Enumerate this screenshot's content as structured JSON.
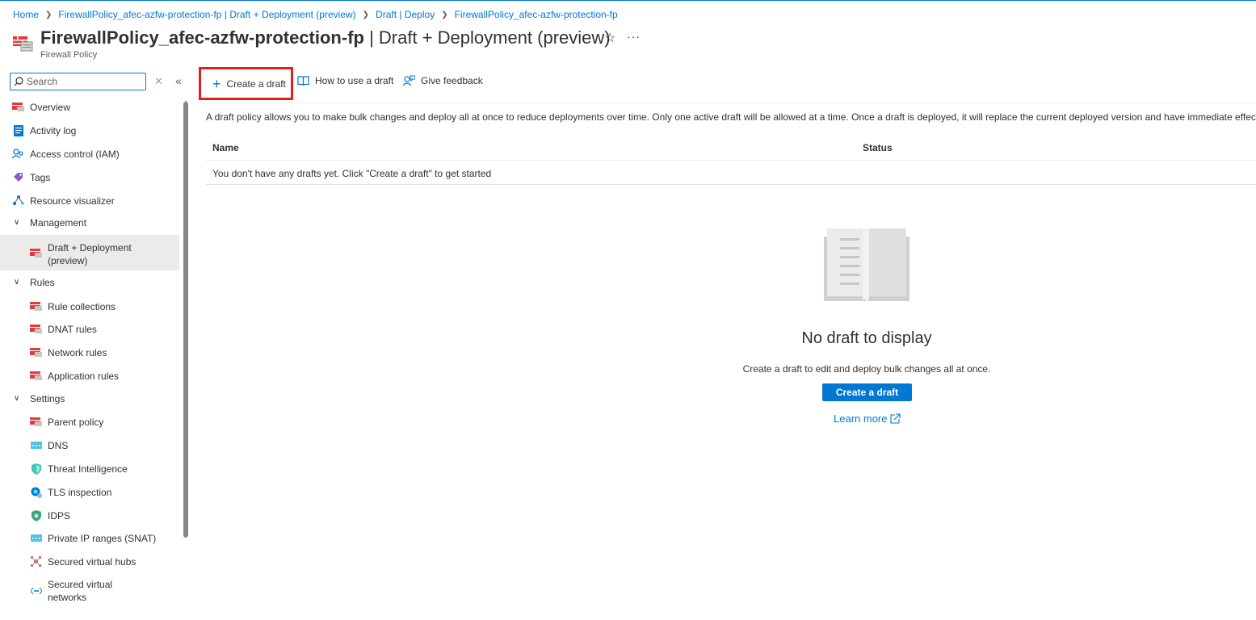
{
  "breadcrumb": [
    "Home",
    "FirewallPolicy_afec-azfw-protection-fp | Draft + Deployment (preview)",
    "Draft | Deploy",
    "FirewallPolicy_afec-azfw-protection-fp"
  ],
  "header": {
    "title_bold": "FirewallPolicy_afec-azfw-protection-fp",
    "title_rest": " | Draft + Deployment (preview)",
    "subtitle": "Firewall Policy",
    "favorite_icon": "star-icon",
    "more_icon": "ellipsis-icon"
  },
  "sidebar": {
    "search_placeholder": "Search",
    "items": [
      {
        "label": "Overview",
        "icon": "firewall-policy-icon"
      },
      {
        "label": "Activity log",
        "icon": "activity-log-icon"
      },
      {
        "label": "Access control (IAM)",
        "icon": "iam-icon"
      },
      {
        "label": "Tags",
        "icon": "tag-icon"
      },
      {
        "label": "Resource visualizer",
        "icon": "visualizer-icon"
      },
      {
        "label": "Management",
        "icon": "chevron-down-icon"
      },
      {
        "label": "Draft + Deployment",
        "label2": "(preview)",
        "icon": "firewall-policy-icon"
      },
      {
        "label": "Rules",
        "icon": "chevron-down-icon"
      },
      {
        "label": "Rule collections",
        "icon": "firewall-policy-icon"
      },
      {
        "label": "DNAT rules",
        "icon": "firewall-policy-icon"
      },
      {
        "label": "Network rules",
        "icon": "firewall-policy-icon"
      },
      {
        "label": "Application rules",
        "icon": "firewall-policy-icon"
      },
      {
        "label": "Settings",
        "icon": "chevron-down-icon"
      },
      {
        "label": "Parent policy",
        "icon": "firewall-policy-icon"
      },
      {
        "label": "DNS",
        "icon": "dns-icon"
      },
      {
        "label": "Threat Intelligence",
        "icon": "shield-icon"
      },
      {
        "label": "TLS inspection",
        "icon": "tls-icon"
      },
      {
        "label": "IDPS",
        "icon": "shield-icon"
      },
      {
        "label": "Private IP ranges (SNAT)",
        "icon": "ip-range-icon"
      },
      {
        "label": "Secured virtual hubs",
        "icon": "virtual-hub-icon"
      },
      {
        "label": "Secured virtual",
        "label2": "networks",
        "icon": "vnet-icon"
      }
    ]
  },
  "toolbar": {
    "create": "Create a draft",
    "howto": "How to use a draft",
    "feedback": "Give feedback"
  },
  "main": {
    "info": "A draft policy allows you to make bulk changes and deploy all at once to reduce deployments over time. Only one active draft will be allowed at a time. Once a draft is deployed, it will replace the current deployed version and have immediate effect.",
    "columns": [
      "Name",
      "Status"
    ],
    "empty_row": "You don't have any drafts yet. Click \"Create a draft\" to get started",
    "empty_title": "No draft to display",
    "empty_desc": "Create a draft to edit and deploy bulk changes all at once.",
    "create_button": "Create a draft",
    "learn_more": "Learn more"
  },
  "colors": {
    "accent": "#0078d4",
    "highlight": "#e01f1f",
    "active_bg": "#edebe9"
  }
}
